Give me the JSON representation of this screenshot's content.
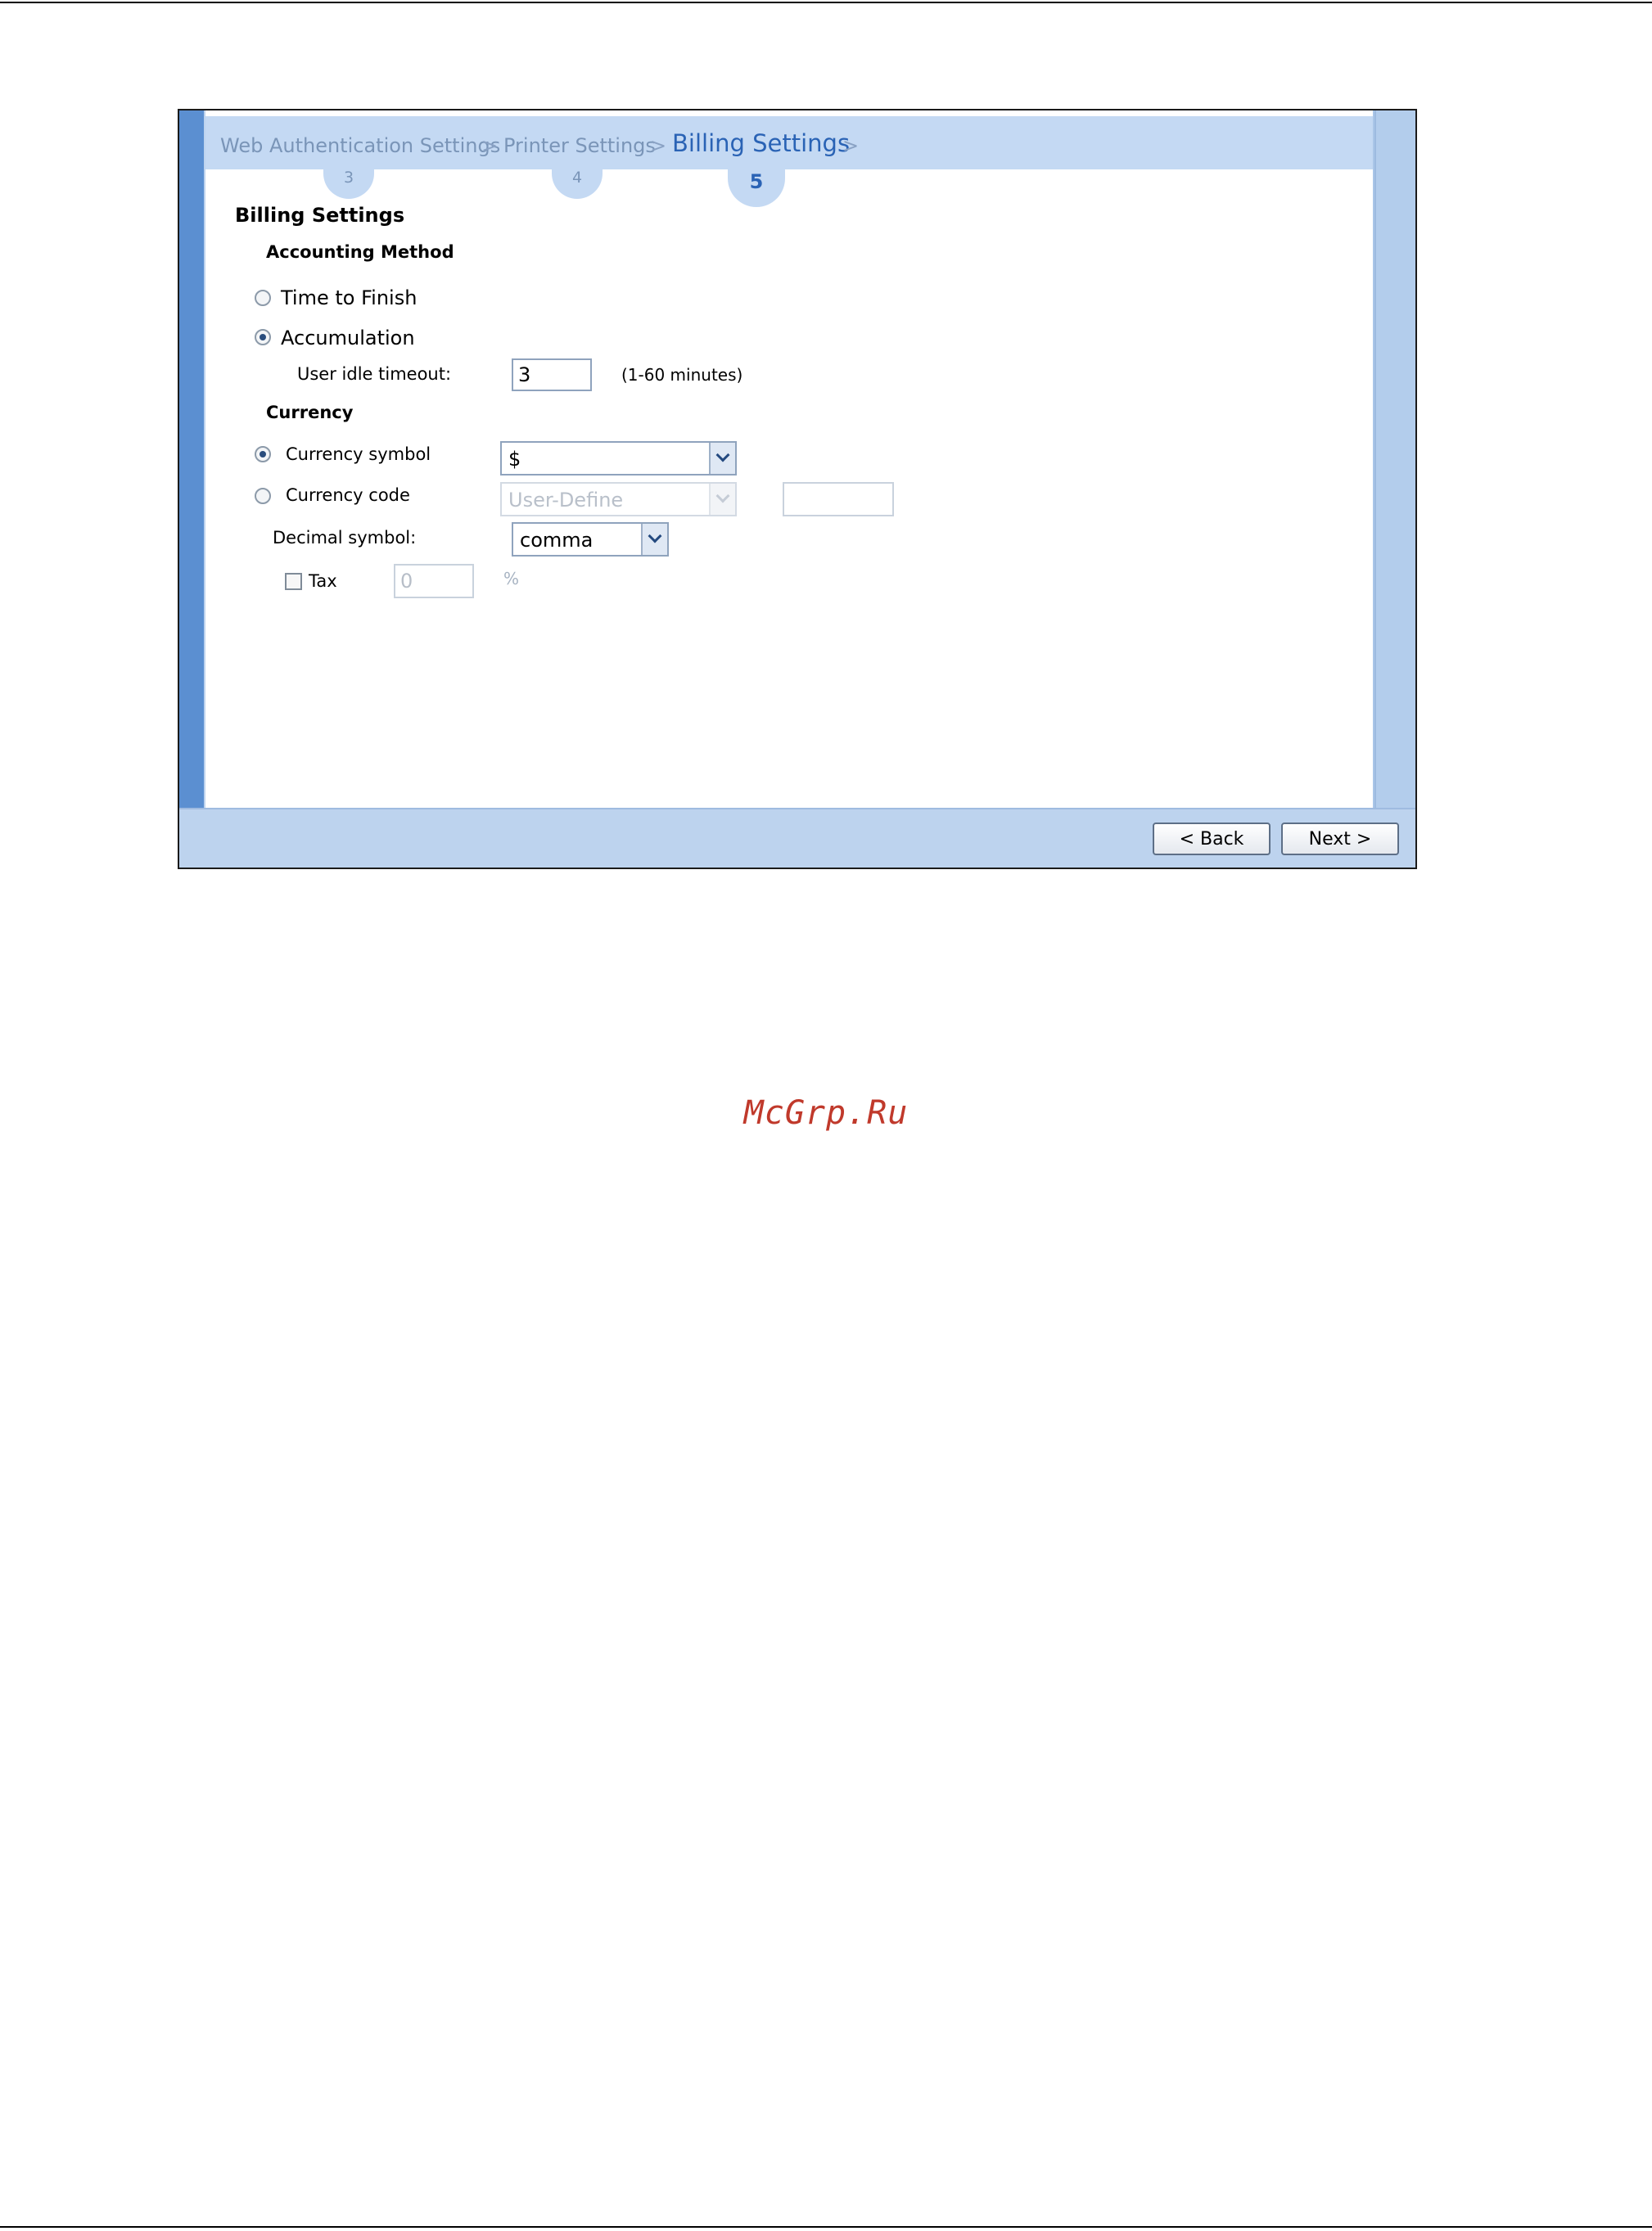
{
  "wizard": {
    "steps": [
      {
        "label": "Web Authentication Settings",
        "number": "3"
      },
      {
        "label": "Printer Settings",
        "number": "4"
      },
      {
        "label": "Billing Settings",
        "number": "5"
      }
    ],
    "separator": ">"
  },
  "form": {
    "section_title": "Billing Settings",
    "accounting": {
      "heading": "Accounting Method",
      "time_to_finish_label": "Time to Finish",
      "accumulation_label": "Accumulation",
      "selected": "Accumulation",
      "idle_timeout_label": "User idle timeout:",
      "idle_timeout_value": "3",
      "idle_timeout_hint": "(1-60 minutes)"
    },
    "currency": {
      "heading": "Currency",
      "symbol_label": "Currency symbol",
      "symbol_value": "$",
      "code_label": "Currency code",
      "code_value": "User-Define",
      "code_custom_value": "",
      "selected": "Currency symbol",
      "decimal_label": "Decimal symbol:",
      "decimal_value": "comma",
      "tax_label": "Tax",
      "tax_checked": false,
      "tax_value": "0",
      "tax_unit": "%"
    }
  },
  "buttons": {
    "back": "< Back",
    "next": "Next >"
  },
  "watermark": "McGrp.Ru",
  "colors": {
    "header_bg": "#c4d9f3",
    "active_step": "#2a63b5",
    "frame_left": "#5b8fd1",
    "footer_bg": "#bdd3ee",
    "watermark": "#c0392b"
  }
}
